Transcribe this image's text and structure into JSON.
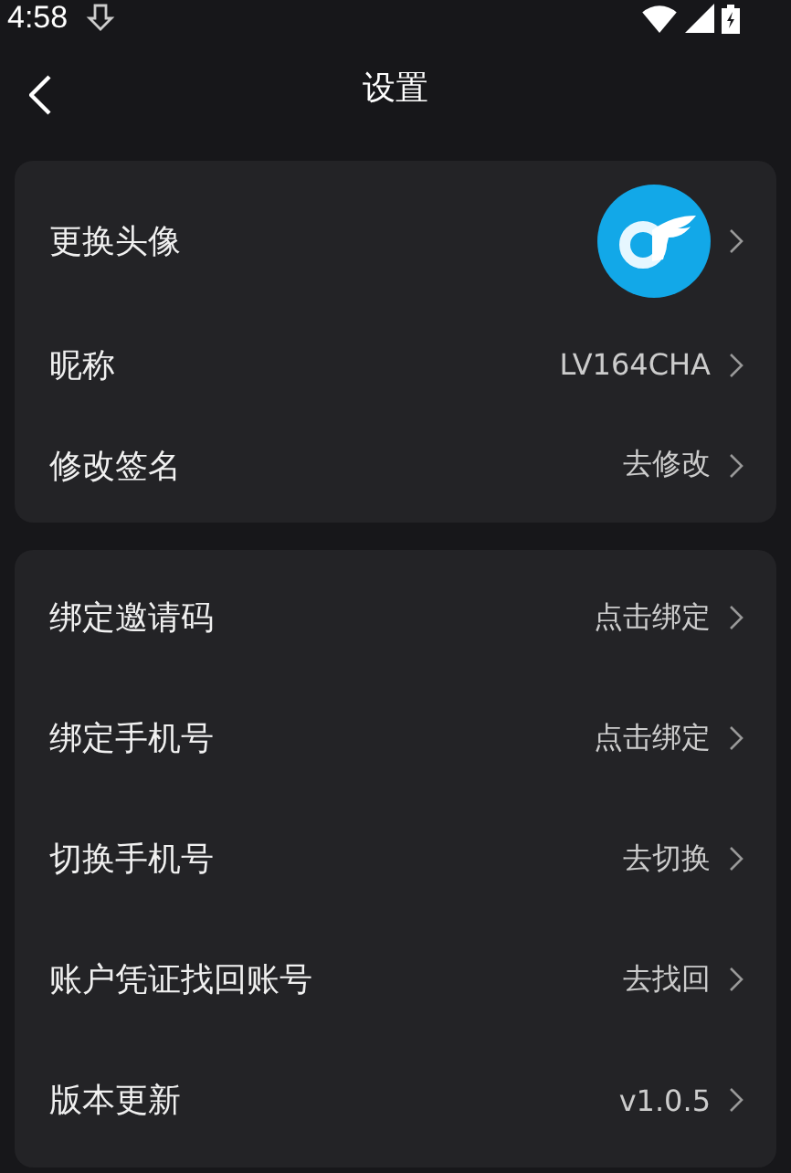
{
  "status_bar": {
    "time": "4:58"
  },
  "header": {
    "title": "设置"
  },
  "groups": [
    {
      "rows": [
        {
          "label": "更换头像",
          "kind": "avatar"
        },
        {
          "label": "昵称",
          "kind": "text",
          "value": "LV164CHA"
        },
        {
          "label": "修改签名",
          "kind": "text",
          "value": "去修改"
        }
      ]
    },
    {
      "rows": [
        {
          "label": "绑定邀请码",
          "kind": "text",
          "value": "点击绑定"
        },
        {
          "label": "绑定手机号",
          "kind": "text",
          "value": "点击绑定"
        },
        {
          "label": "切换手机号",
          "kind": "text",
          "value": "去切换"
        },
        {
          "label": "账户凭证找回账号",
          "kind": "text",
          "value": "去找回"
        },
        {
          "label": "版本更新",
          "kind": "text",
          "value": "v1.0.5"
        }
      ]
    }
  ]
}
